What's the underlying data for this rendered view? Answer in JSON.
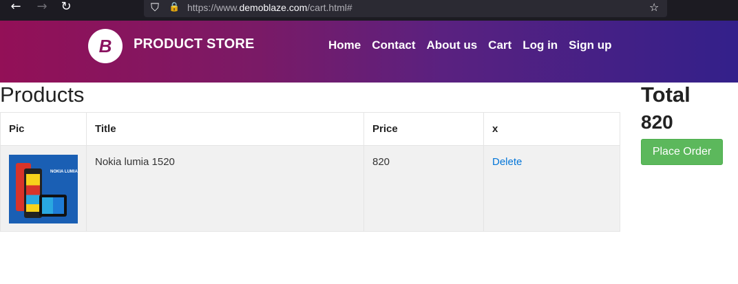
{
  "browser": {
    "back_icon": "←",
    "forward_icon": "→",
    "reload_icon": "↻",
    "shield_icon": "⛉",
    "lock_icon": "🔒",
    "star_icon": "☆",
    "url_prefix": "https://www.",
    "url_domain": "demoblaze.com",
    "url_suffix": "/cart.html#"
  },
  "navbar": {
    "logo_mark": "B",
    "brand": "PRODUCT STORE",
    "links": [
      "Home",
      "Contact",
      "About us",
      "Cart",
      "Log in",
      "Sign up"
    ]
  },
  "products": {
    "title": "Products",
    "columns": [
      "Pic",
      "Title",
      "Price",
      "x"
    ],
    "rows": [
      {
        "thumbnail": "nokia-lumia-1520-image",
        "thumbnail_label": "NOKIA LUMIA",
        "title": "Nokia lumia 1520",
        "price": "820",
        "action": "Delete"
      }
    ]
  },
  "summary": {
    "total_label": "Total",
    "total_value": "820",
    "place_order_label": "Place Order"
  },
  "colors": {
    "navbar_start": "#931057",
    "navbar_end": "#33208a",
    "place_order_bg": "#5cb85c",
    "link": "#0275d8"
  }
}
